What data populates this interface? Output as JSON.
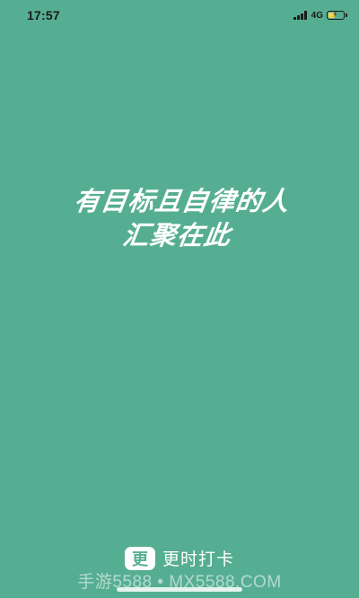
{
  "status_bar": {
    "time": "17:57",
    "network": "4G",
    "signal_icon": "signal-bars-icon",
    "battery_icon": "battery-charging-icon",
    "battery_level": 0.5,
    "battery_color": "#f7d548"
  },
  "slogan": {
    "line1": "有目标且自律的人",
    "line2": "汇聚在此"
  },
  "brand": {
    "logo_char": "更",
    "name": "更时打卡"
  },
  "watermark": {
    "text": "手游5588 • MX5588.COM"
  },
  "colors": {
    "background": "#56ae92",
    "text": "#ffffff"
  }
}
